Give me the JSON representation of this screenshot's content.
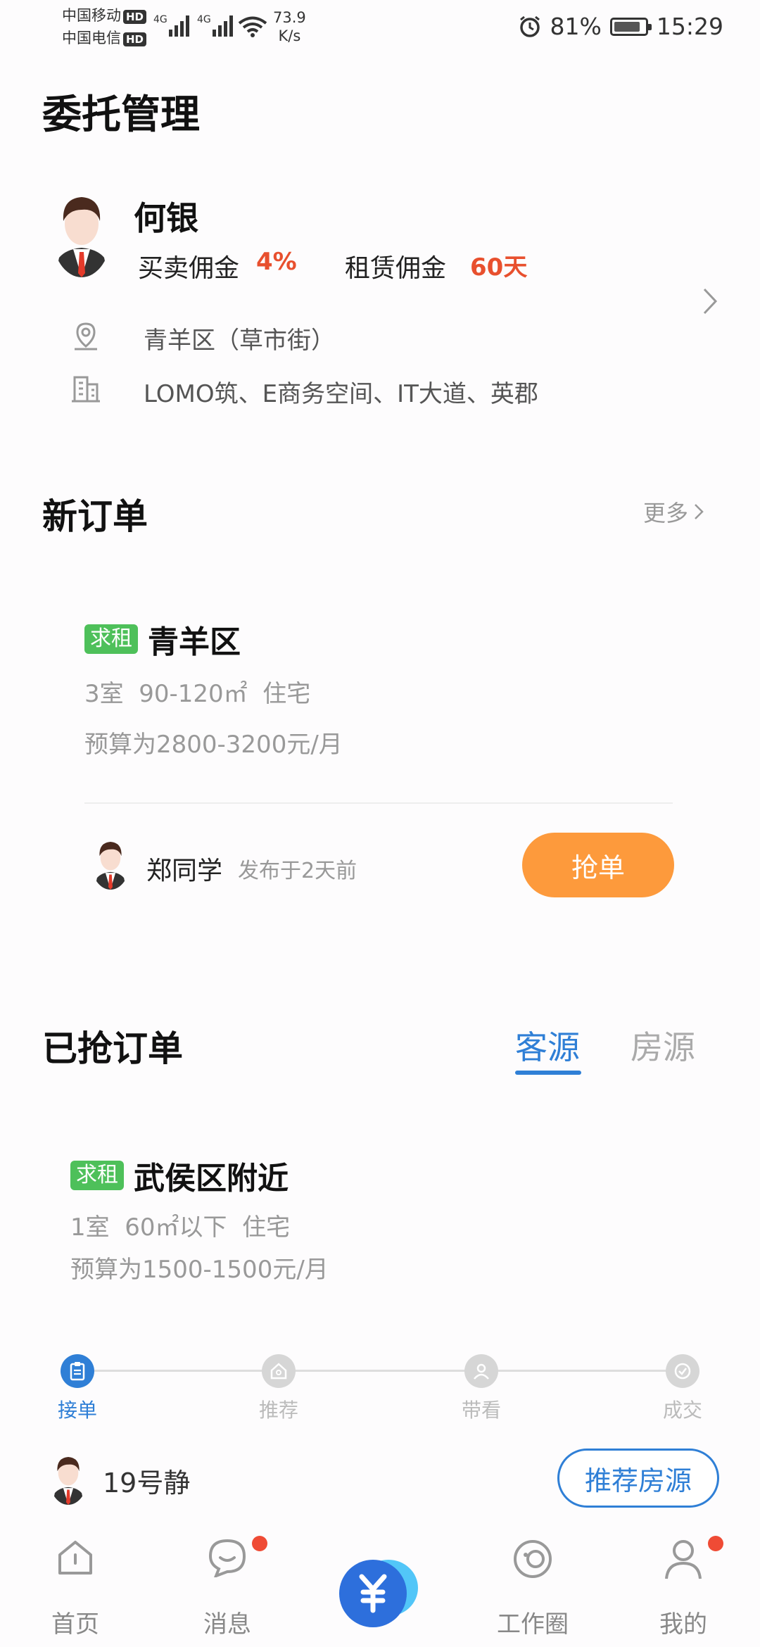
{
  "status_bar": {
    "carrier1": "中国移动",
    "carrier2": "中国电信",
    "hd": "HD",
    "network": "4G",
    "speed_value": "73.9",
    "speed_unit": "K/s",
    "battery": "81%",
    "time": "15:29"
  },
  "page": {
    "title": "委托管理"
  },
  "agent": {
    "name": "何银",
    "sale_commission_label": "买卖佣金",
    "sale_commission_value": "4%",
    "rent_commission_label": "租赁佣金",
    "rent_commission_value": "60天",
    "area": "青羊区（草市街）",
    "buildings": "LOMO筑、E商务空间、IT大道、英郡"
  },
  "new_orders": {
    "title": "新订单",
    "more": "更多",
    "order": {
      "tag": "求租",
      "district": "青羊区",
      "specs": "3室  90-120㎡  住宅",
      "budget": "预算为2800-3200元/月",
      "publisher": "郑同学",
      "published": "发布于2天前",
      "grab_button": "抢单"
    }
  },
  "grabbed_orders": {
    "title": "已抢订单",
    "tabs": [
      {
        "label": "客源",
        "active": true
      },
      {
        "label": "房源",
        "active": false
      }
    ],
    "order": {
      "tag": "求租",
      "district": "武侯区附近",
      "specs": "1室  60㎡以下  住宅",
      "budget": "预算为1500-1500元/月",
      "steps": [
        "接单",
        "推荐",
        "带看",
        "成交"
      ],
      "current_step": 0,
      "client": "19号静",
      "recommend_button": "推荐房源"
    }
  },
  "bottom_nav": {
    "items": [
      {
        "label": "首页",
        "icon": "home-icon"
      },
      {
        "label": "消息",
        "icon": "message-icon",
        "badge": true
      },
      {
        "label": "",
        "icon": "yuan-icon"
      },
      {
        "label": "工作圈",
        "icon": "work-circle-icon"
      },
      {
        "label": "我的",
        "icon": "profile-icon",
        "badge": true
      }
    ]
  },
  "colors": {
    "accent_blue": "#2f7fd6",
    "orange": "#fd9a3c",
    "green_tag": "#4ec05a",
    "red_value": "#e8502e"
  }
}
